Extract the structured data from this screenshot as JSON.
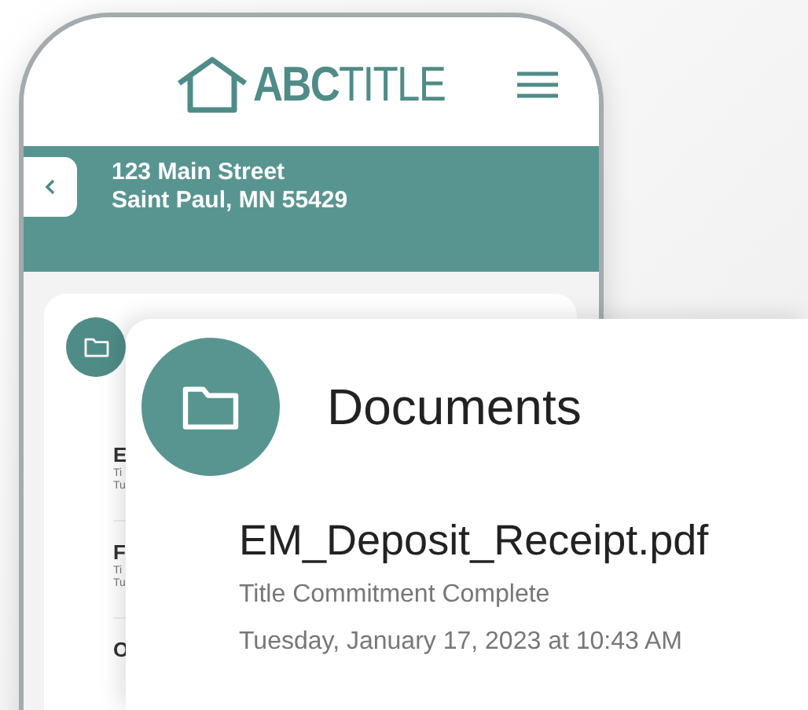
{
  "header": {
    "logo": "**ABC**TITLE"
  },
  "address": {
    "line1": "123 Main Street",
    "line2": "Saint Paul, MN 55429"
  },
  "list": {
    "items": [
      {
        "name": "E",
        "subtitle": "Ti",
        "date": "Tu"
      },
      {
        "name": "F",
        "subtitle": "Ti",
        "date": "Tu"
      },
      {
        "name": "O"
      }
    ]
  },
  "documents_card": {
    "title": "Documents",
    "file_name": "EM_Deposit_Receipt.pdf",
    "status": "Title Commitment Complete",
    "date": "Tuesday, January 17, 2023 at 10:43 AM"
  }
}
